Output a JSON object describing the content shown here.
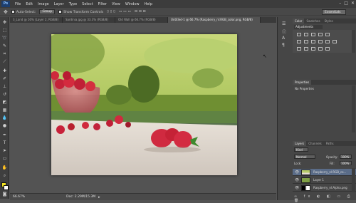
{
  "menu": {
    "logo": "Ps",
    "items": [
      "File",
      "Edit",
      "Image",
      "Layer",
      "Type",
      "Select",
      "Filter",
      "View",
      "Window",
      "Help"
    ],
    "window_controls": [
      "–",
      "□",
      "✕"
    ]
  },
  "options": {
    "auto_select": "Auto-Select:",
    "group": "Group",
    "show_transform": "Show Transform Controls",
    "workspace": "Essentials"
  },
  "tabs": [
    {
      "label": "3_Land @ 16% (Layer 2, RGB/8)",
      "active": false
    },
    {
      "label": "Sardinia.jpg @ 33.3% (RGB/8)",
      "active": false
    },
    {
      "label": "Old Wall @ 66.7% (RGB/8)",
      "active": false
    },
    {
      "label": "Untitled-1 @ 66.7% (Raspberry_nl:RGB_color.png, RGB/8)",
      "active": true
    }
  ],
  "status": {
    "zoom": "66.67%",
    "doc": "Doc: 2.29M/15.3M"
  },
  "panels": {
    "top_tabs": [
      "Color",
      "Swatches",
      "Styles"
    ],
    "adjustments_label": "Adjustments",
    "properties_tab": "Properties",
    "properties_text": "No Properties",
    "layers_tabs": [
      "Layers",
      "Channels",
      "Paths"
    ],
    "kind": "Kind",
    "blend_mode": "Normal",
    "opacity_label": "Opacity:",
    "opacity_value": "100%",
    "lock_label": "Lock:",
    "fill_label": "Fill:",
    "fill_value": "100%",
    "layers": [
      {
        "name": "Raspberry_nl:RGB_co...",
        "selected": true
      },
      {
        "name": "Layer 1",
        "selected": false
      },
      {
        "name": "Raspberry_nl:Alpha.png",
        "selected": false
      }
    ]
  }
}
